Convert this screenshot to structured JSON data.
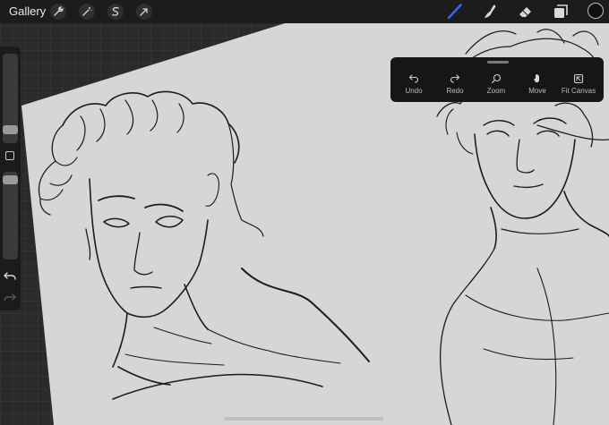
{
  "topbar": {
    "gallery_label": "Gallery",
    "left_tools": [
      {
        "name": "actions",
        "icon": "wrench-icon"
      },
      {
        "name": "adjustments",
        "icon": "magic-wand-icon"
      },
      {
        "name": "selection",
        "icon": "selection-s-icon"
      },
      {
        "name": "transform",
        "icon": "arrow-cursor-icon"
      }
    ],
    "right_tools": [
      {
        "name": "brush",
        "icon": "brush-icon",
        "active": true
      },
      {
        "name": "smudge",
        "icon": "smudge-icon"
      },
      {
        "name": "eraser",
        "icon": "eraser-icon"
      },
      {
        "name": "layers",
        "icon": "layers-icon"
      }
    ],
    "active_tool_color": "#2f6bff",
    "current_color": "#0f0f0f"
  },
  "sidebar": {
    "brush_size_level": 0.25,
    "brush_opacity_level": 0.1,
    "modify_button_icon": "square-icon",
    "undo_icon": "undo-icon",
    "redo_icon": "redo-icon"
  },
  "quick_menu": {
    "items": [
      {
        "label": "Undo",
        "icon": "undo-arrow-icon"
      },
      {
        "label": "Redo",
        "icon": "redo-arrow-icon"
      },
      {
        "label": "Zoom",
        "icon": "magnifier-icon"
      },
      {
        "label": "Move",
        "icon": "hand-icon"
      },
      {
        "label": "Fit Canvas",
        "icon": "fit-canvas-icon"
      }
    ]
  },
  "canvas": {
    "background_color": "#d6d6d6",
    "content": "sketch"
  }
}
